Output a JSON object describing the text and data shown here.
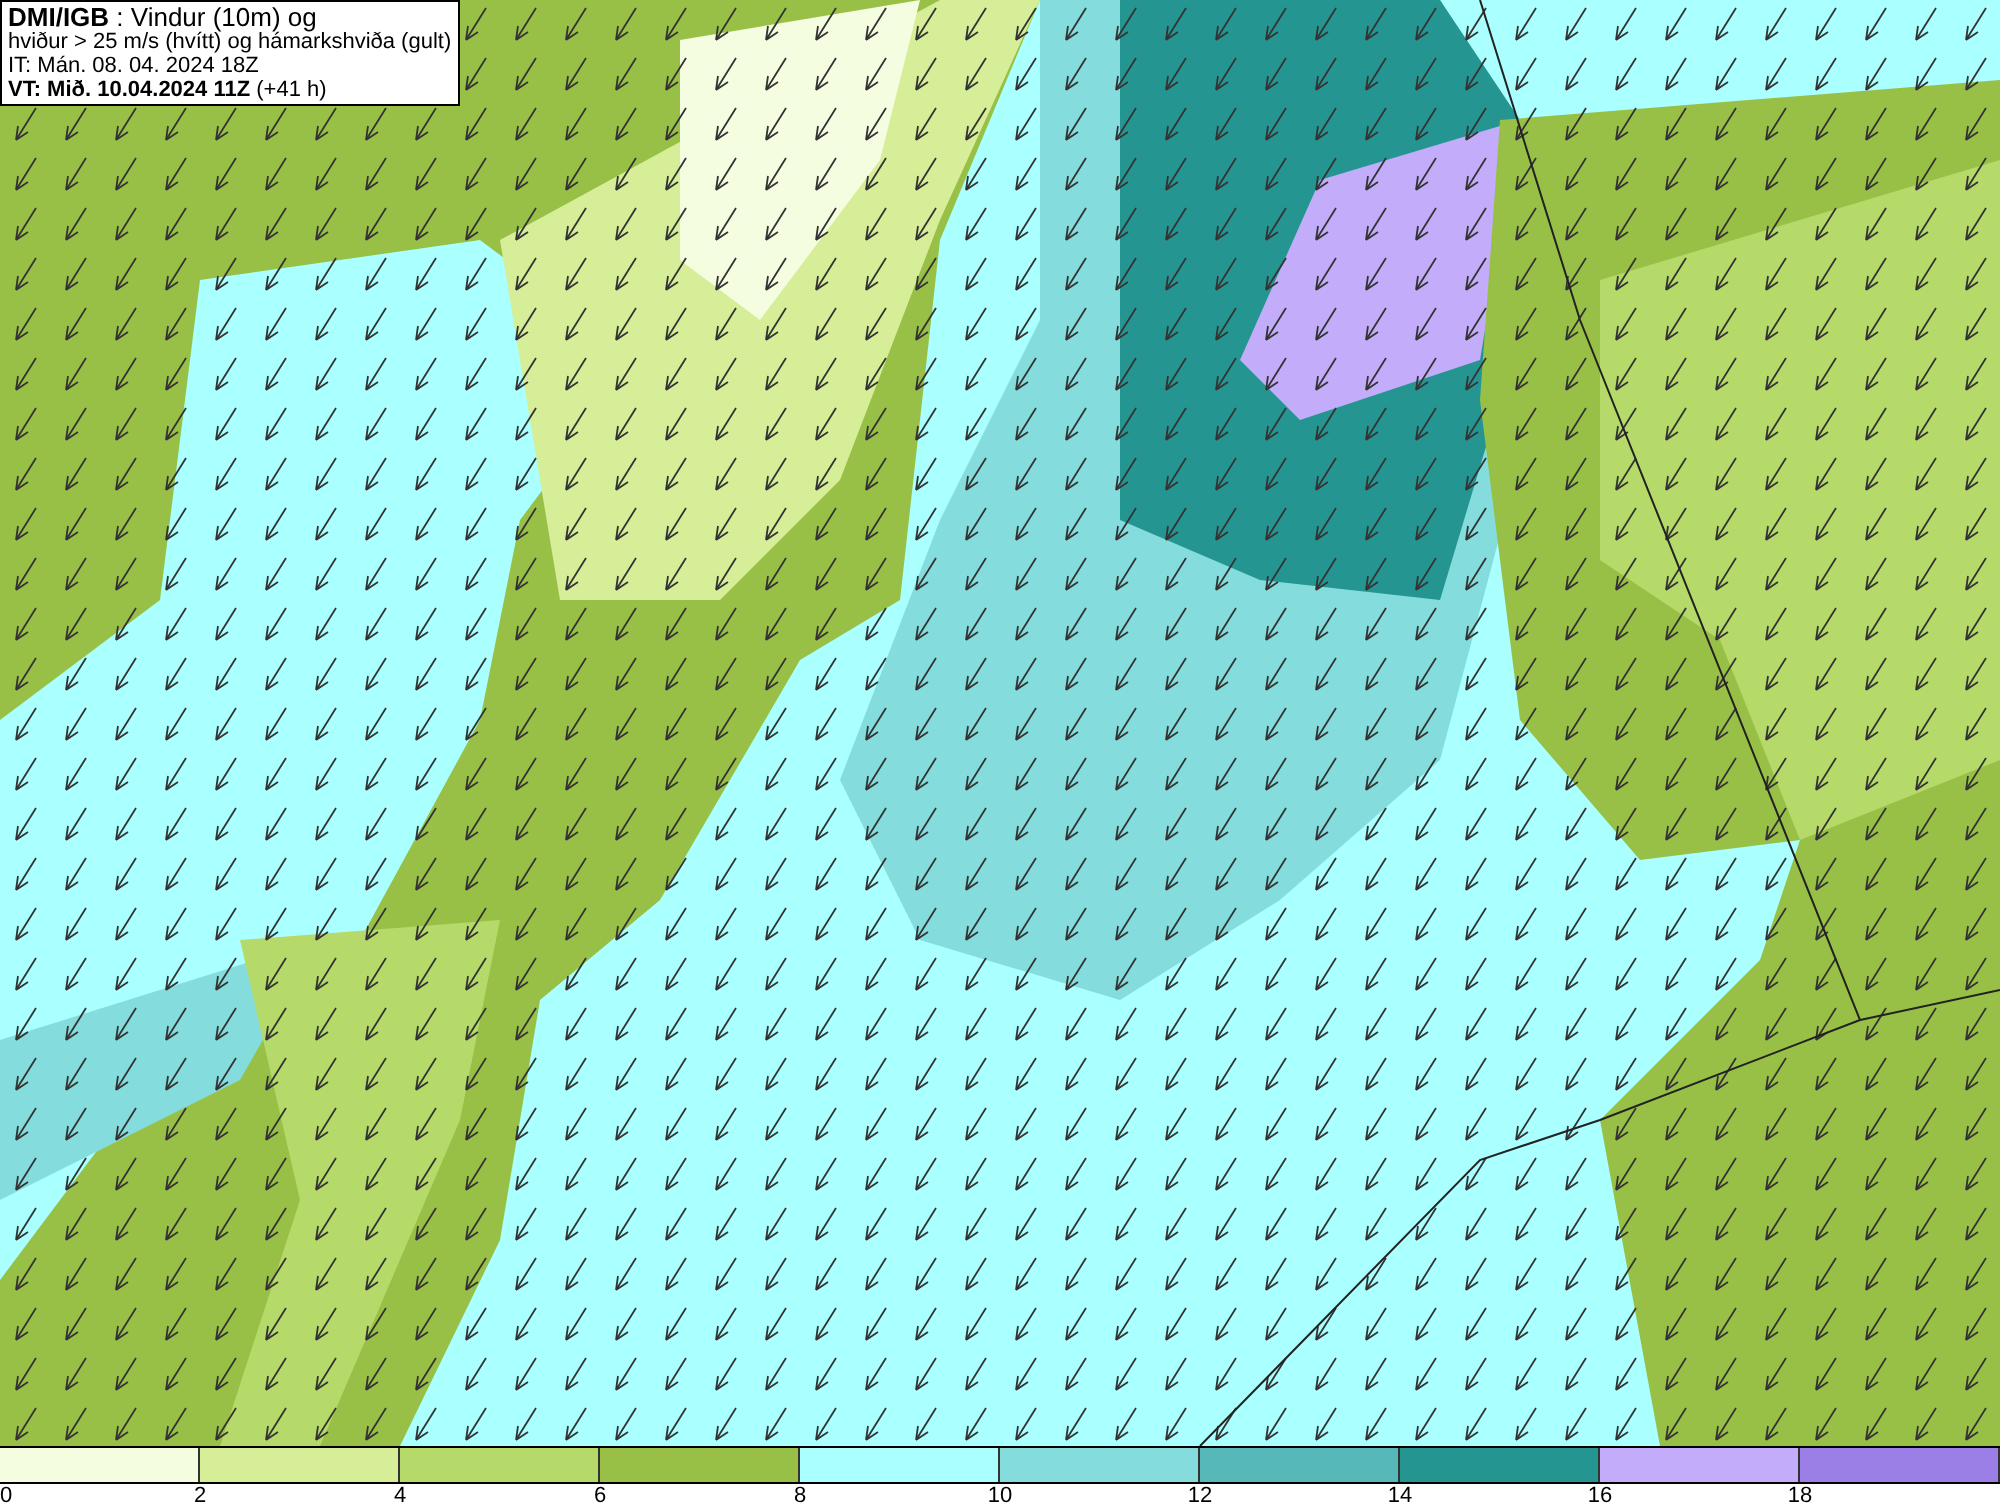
{
  "info_box": {
    "lines": [
      "**DMI/IGB** : Vindur (10m) og",
      "hviður > 25 m/s (hvítt) og hámarkshviða (gult)",
      "IT: Mán. 08. 04. 2024 18Z",
      "**VT: Mið. 10.04.2024 11Z** (+41 h)"
    ]
  },
  "legend": {
    "bins": [
      {
        "color": "#f5fde0"
      },
      {
        "color": "#d6ee98"
      },
      {
        "color": "#b5da6a"
      },
      {
        "color": "#98c046"
      },
      {
        "color": "#aaffff"
      },
      {
        "color": "#84dcdc"
      },
      {
        "color": "#56b8b8"
      },
      {
        "color": "#259592"
      },
      {
        "color": "#c3adfa"
      },
      {
        "color": "#9b7fe6"
      }
    ],
    "labels": [
      "0",
      "2",
      "4",
      "6",
      "8",
      "10",
      "12",
      "14",
      "16",
      "18"
    ]
  }
}
